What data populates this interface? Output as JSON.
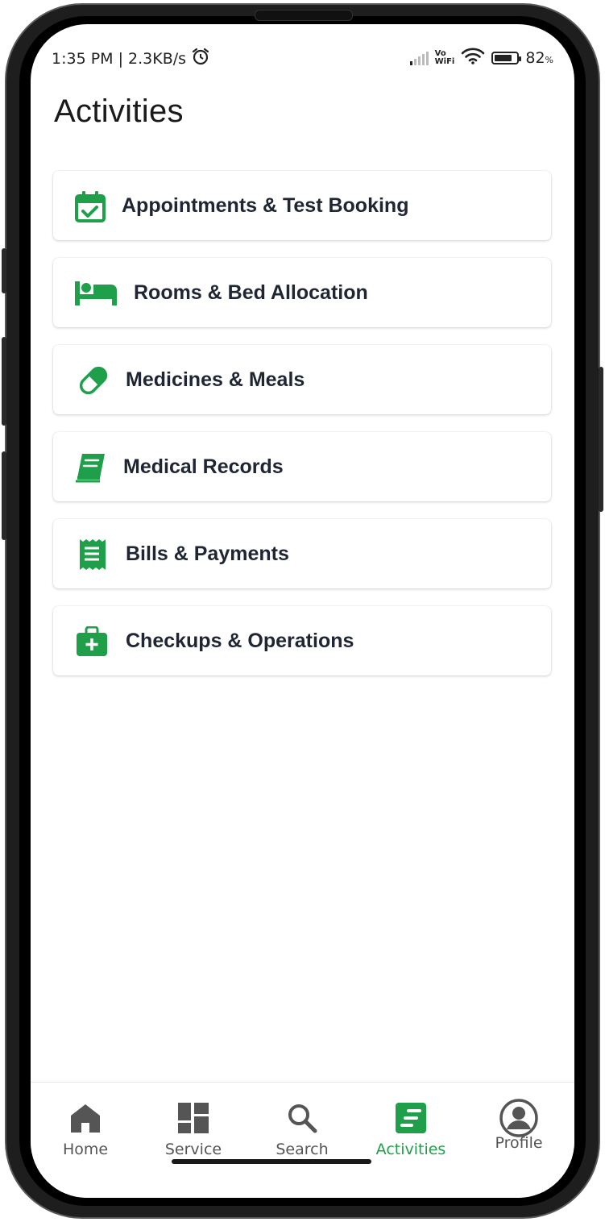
{
  "status_bar": {
    "time_speed": "1:35 PM | 2.3KB/s",
    "vowifi_line1": "Vo",
    "vowifi_line2": "WiFi",
    "battery_percent": "82",
    "battery_unit": "%",
    "battery_level": 0.82
  },
  "page": {
    "title": "Activities"
  },
  "accent_color": "#1f9f4a",
  "items": [
    {
      "label": "Appointments & Test Booking",
      "icon": "calendar-check-icon"
    },
    {
      "label": "Rooms & Bed Allocation",
      "icon": "bed-icon"
    },
    {
      "label": "Medicines & Meals",
      "icon": "capsule-icon"
    },
    {
      "label": "Medical Records",
      "icon": "book-icon"
    },
    {
      "label": "Bills & Payments",
      "icon": "receipt-icon"
    },
    {
      "label": "Checkups & Operations",
      "icon": "medical-kit-icon"
    }
  ],
  "nav": [
    {
      "label": "Home",
      "icon": "home-icon",
      "active": false
    },
    {
      "label": "Service",
      "icon": "grid-icon",
      "active": false
    },
    {
      "label": "Search",
      "icon": "search-icon",
      "active": false
    },
    {
      "label": "Activities",
      "icon": "activities-icon",
      "active": true
    },
    {
      "label": "Profile",
      "icon": "profile-icon",
      "active": false
    }
  ]
}
